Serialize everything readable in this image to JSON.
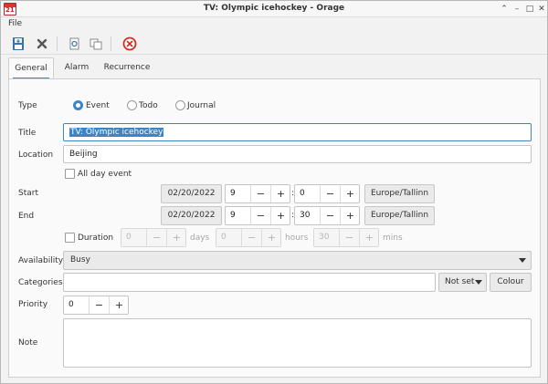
{
  "window": {
    "title": "TV: Olympic icehockey - Orage",
    "app_icon_text": "21",
    "controls": {
      "minimize": "⌃",
      "shade": "–",
      "maximize": "□",
      "close": "✕"
    }
  },
  "menu": {
    "file": "File"
  },
  "toolbar": {
    "icons": [
      "save-icon",
      "close-x-icon",
      "duplicate-icon",
      "copy-icon",
      "delete-icon"
    ],
    "colors": {
      "save": "#3a6fb0",
      "delete": "#d9281e"
    }
  },
  "tabs": [
    {
      "label": "General",
      "active": true
    },
    {
      "label": "Alarm",
      "active": false
    },
    {
      "label": "Recurrence",
      "active": false
    }
  ],
  "form": {
    "type": {
      "label": "Type",
      "options": [
        {
          "label": "Event",
          "selected": true
        },
        {
          "label": "Todo",
          "selected": false
        },
        {
          "label": "Journal",
          "selected": false
        }
      ]
    },
    "title": {
      "label": "Title",
      "value": "TV: Olympic icehockey"
    },
    "location": {
      "label": "Location",
      "value": "Beijing"
    },
    "all_day": {
      "label": "All day event",
      "checked": false
    },
    "start": {
      "label": "Start",
      "date": "02/20/2022",
      "hour": "9",
      "minute": "0",
      "timezone": "Europe/Tallinn"
    },
    "end": {
      "label": "End",
      "date": "02/20/2022",
      "hour": "9",
      "minute": "30",
      "timezone": "Europe/Tallinn"
    },
    "duration": {
      "label": "Duration",
      "checked": false,
      "days": "0",
      "days_label": "days",
      "hours": "0",
      "hours_label": "hours",
      "mins": "30",
      "mins_label": "mins"
    },
    "availability": {
      "label": "Availability",
      "value": "Busy"
    },
    "categories": {
      "label": "Categories",
      "value": "",
      "not_set_label": "Not set",
      "colour_label": "Colour"
    },
    "priority": {
      "label": "Priority",
      "value": "0"
    },
    "note": {
      "label": "Note",
      "value": ""
    }
  },
  "spin_glyphs": {
    "minus": "−",
    "plus": "+",
    "colon": ":"
  },
  "colors": {
    "accent": "#3c84c8"
  }
}
